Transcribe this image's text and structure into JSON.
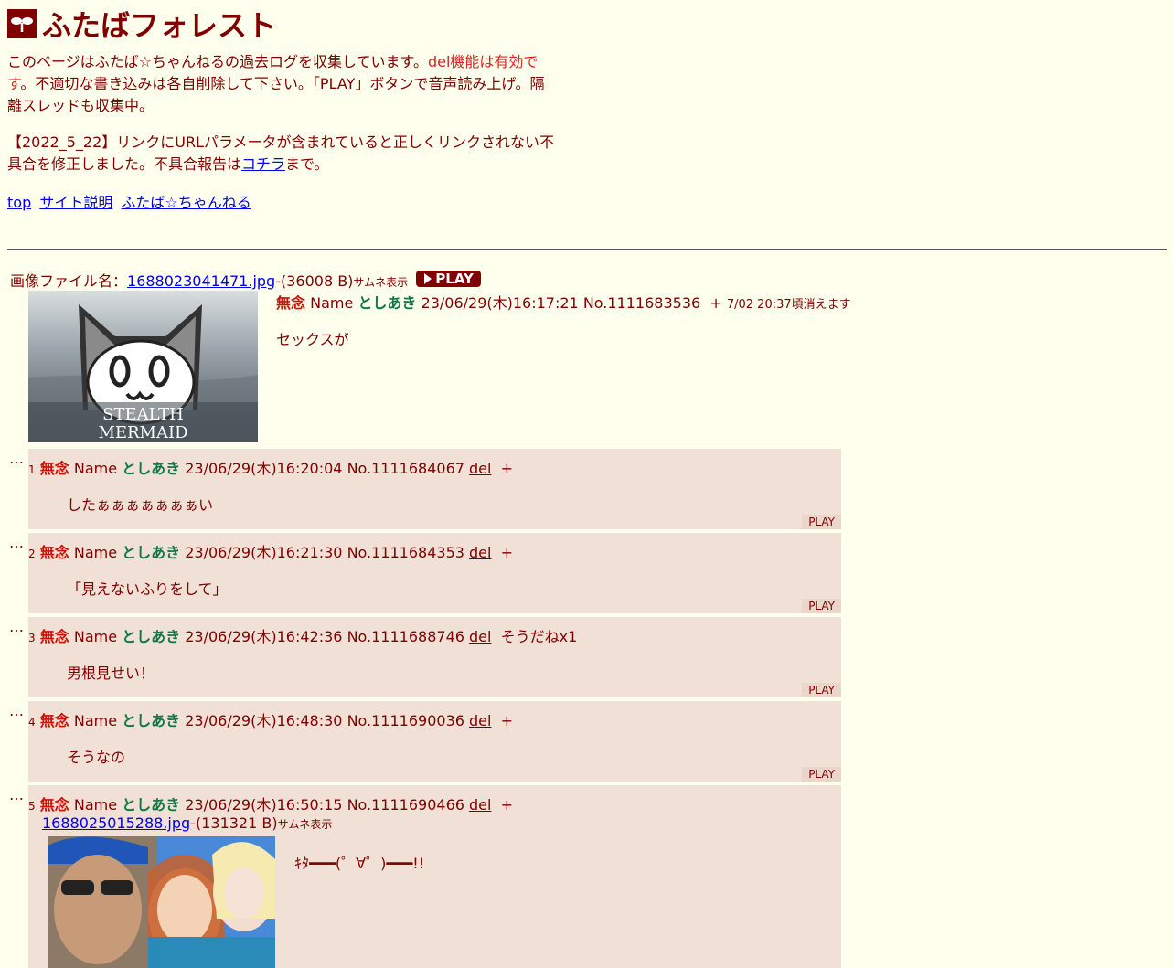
{
  "site": {
    "title": "ふたばフォレスト",
    "intro_pre": "このページはふたば☆ちゃんねるの過去ログを収集しています。",
    "intro_red": "del機能は有効です",
    "intro_post": "。不適切な書き込みは各自削除して下さい。「PLAY」ボタンで音声読み上げ。隔離スレッドも収集中。",
    "notice_pre": "【2022_5_22】リンクにURLパラメータが含まれていると正しくリンクされない不具合を修正しました。不具合報告は",
    "notice_link": "コチラ",
    "notice_post": "まで。"
  },
  "nav": [
    "top",
    "サイト説明",
    "ふたば☆ちゃんねる"
  ],
  "op": {
    "file_label": "画像ファイル名：",
    "file_name": "1688023041471.jpg",
    "file_size": "-(36008 B)",
    "thumb_label": "サムネ表示",
    "play": "PLAY",
    "subject": "無念",
    "name_label": "Name",
    "name": "としあき",
    "datetime": "23/06/29(木)16:17:21",
    "number": "No.1111683536",
    "plus": "+",
    "expire": "7/02 20:37頃消えます",
    "body": "セックスが",
    "thumb_text_1": "STEALTH",
    "thumb_text_2": "MERMAID"
  },
  "reply_marker": "…",
  "replies": [
    {
      "num": "1",
      "subject": "無念",
      "name_label": "Name",
      "name": "としあき",
      "datetime": "23/06/29(木)16:20:04",
      "number": "No.1111684067",
      "del": "del",
      "extra": "+",
      "body": "したぁぁぁぁぁぁぁい",
      "play": "PLAY"
    },
    {
      "num": "2",
      "subject": "無念",
      "name_label": "Name",
      "name": "としあき",
      "datetime": "23/06/29(木)16:21:30",
      "number": "No.1111684353",
      "del": "del",
      "extra": "+",
      "body": "「見えないふりをして」",
      "play": "PLAY"
    },
    {
      "num": "3",
      "subject": "無念",
      "name_label": "Name",
      "name": "としあき",
      "datetime": "23/06/29(木)16:42:36",
      "number": "No.1111688746",
      "del": "del",
      "extra": "そうだねx1",
      "body": "男根見せい！",
      "play": "PLAY"
    },
    {
      "num": "4",
      "subject": "無念",
      "name_label": "Name",
      "name": "としあき",
      "datetime": "23/06/29(木)16:48:30",
      "number": "No.1111690036",
      "del": "del",
      "extra": "+",
      "body": "そうなの",
      "play": "PLAY"
    },
    {
      "num": "5",
      "subject": "無念",
      "name_label": "Name",
      "name": "としあき",
      "datetime": "23/06/29(木)16:50:15",
      "number": "No.1111690466",
      "del": "del",
      "extra": "+",
      "file_name": "1688025015288.jpg",
      "file_size": "-(131321 B)",
      "thumb_label": "サムネ表示",
      "body": "ｷﾀ━━━(゜∀゜)━━━!!"
    }
  ]
}
